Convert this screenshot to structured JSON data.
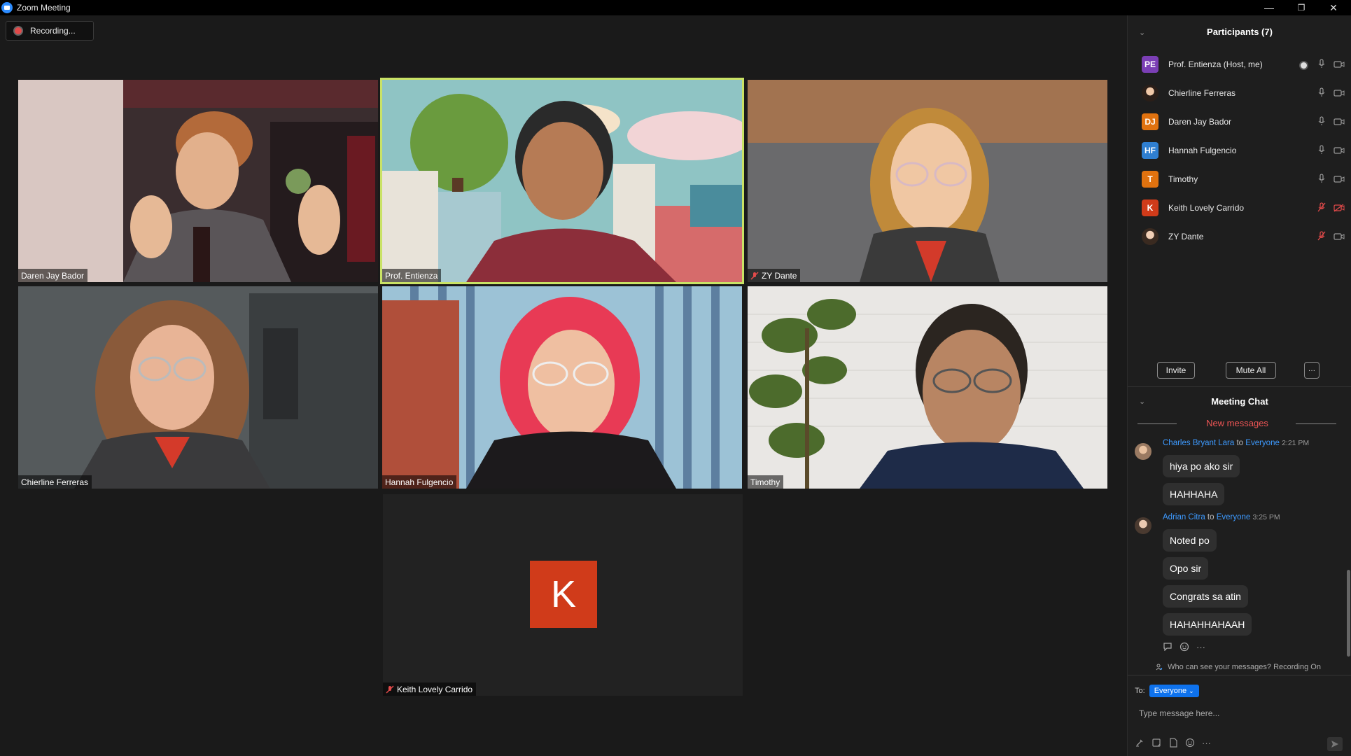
{
  "window": {
    "title": "Zoom Meeting",
    "minimize": "—",
    "restore": "❐",
    "close": "✕"
  },
  "recording": {
    "label": "Recording..."
  },
  "tiles": [
    {
      "name": "Daren Jay Bador"
    },
    {
      "name": "Prof. Entienza"
    },
    {
      "name": "ZY Dante",
      "muted": true
    },
    {
      "name": "Chierline Ferreras"
    },
    {
      "name": "Hannah Fulgencio"
    },
    {
      "name": "Timothy"
    },
    {
      "name": "Keith Lovely Carrido",
      "muted": true,
      "avatar_letter": "K"
    }
  ],
  "participants_panel": {
    "title": "Participants (7)",
    "items": [
      {
        "initials": "PE",
        "color": "#7b3fb5",
        "name": "Prof. Entienza (Host, me)",
        "mic": "on",
        "video": "on",
        "recording": true
      },
      {
        "initials": "",
        "color": "#cccccc",
        "name": "Chierline Ferreras",
        "mic": "on",
        "video": "on"
      },
      {
        "initials": "DJ",
        "color": "#e0720f",
        "name": "Daren Jay Bador",
        "mic": "on",
        "video": "on"
      },
      {
        "initials": "HF",
        "color": "#2f7fd1",
        "name": "Hannah Fulgencio",
        "mic": "on",
        "video": "on"
      },
      {
        "initials": "T",
        "color": "#e0720f",
        "name": "Timothy",
        "mic": "on",
        "video": "on"
      },
      {
        "initials": "K",
        "color": "#d03b1a",
        "name": "Keith Lovely Carrido",
        "mic": "muted",
        "video": "off"
      },
      {
        "initials": "",
        "color": "#cccccc",
        "name": "ZY Dante",
        "mic": "muted",
        "video": "on"
      }
    ],
    "invite_label": "Invite",
    "mute_all_label": "Mute All",
    "more_label": "···"
  },
  "chat": {
    "title": "Meeting Chat",
    "new_messages": "New messages",
    "groups": [
      {
        "sender": "Charles Bryant Lara",
        "to_word": "to",
        "recipient": "Everyone",
        "time": "2:21 PM",
        "messages": [
          "hiya po ako sir",
          "HAHHAHA"
        ]
      },
      {
        "sender": "Adrian Citra",
        "to_word": "to",
        "recipient": "Everyone",
        "time": "3:25 PM",
        "messages": [
          "Noted po",
          "Opo sir",
          "Congrats sa atin",
          "HAHAHHAHAAH"
        ]
      }
    ],
    "who_can_see": "Who can see your messages? Recording On",
    "to_label": "To:",
    "to_value": "Everyone",
    "input_placeholder": "Type message here..."
  }
}
